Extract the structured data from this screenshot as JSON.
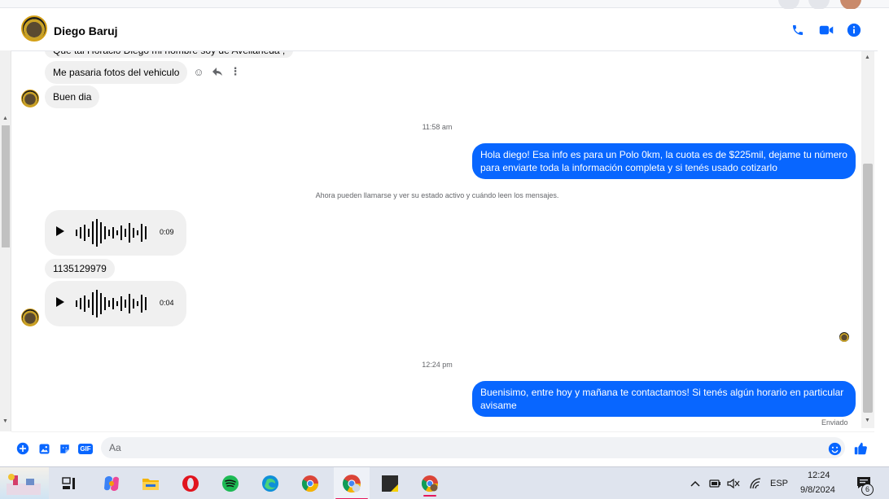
{
  "header": {
    "contact_name": "Diego Baruj",
    "icons": [
      "phone-icon",
      "video-camera-icon",
      "info-icon"
    ]
  },
  "conversation": {
    "cut_message": "Que tal Horacio Diego mi nombre soy de Avellaneda ,",
    "incoming_1": "Me pasaria fotos del vehiculo",
    "incoming_2": "Buen dia",
    "timestamp_1": "11:58 am",
    "outgoing_1": "Hola diego! Esa info es para un Polo 0km, la cuota es de $225mil, dejame tu número para enviarte toda la información completa y si tenés usado cotizarlo",
    "system_notice": "Ahora pueden llamarse y ver su estado activo y cuándo leen los mensajes.",
    "voice_1_duration": "0:09",
    "incoming_phone": "1135129979",
    "voice_2_duration": "0:04",
    "timestamp_2": "12:24 pm",
    "outgoing_2": "Buenisimo, entre hoy y mañana te contactamos! Si tenés algún horario en particular avisame",
    "status": "Enviado"
  },
  "composer": {
    "placeholder": "Aa",
    "gif_label": "GIF"
  },
  "taskbar": {
    "language": "ESP",
    "time": "12:24",
    "date": "9/8/2024",
    "notification_count": "6"
  },
  "colors": {
    "accent": "#0866ff",
    "incoming_bubble": "#f0f0f0",
    "meta_text": "#65676b"
  }
}
